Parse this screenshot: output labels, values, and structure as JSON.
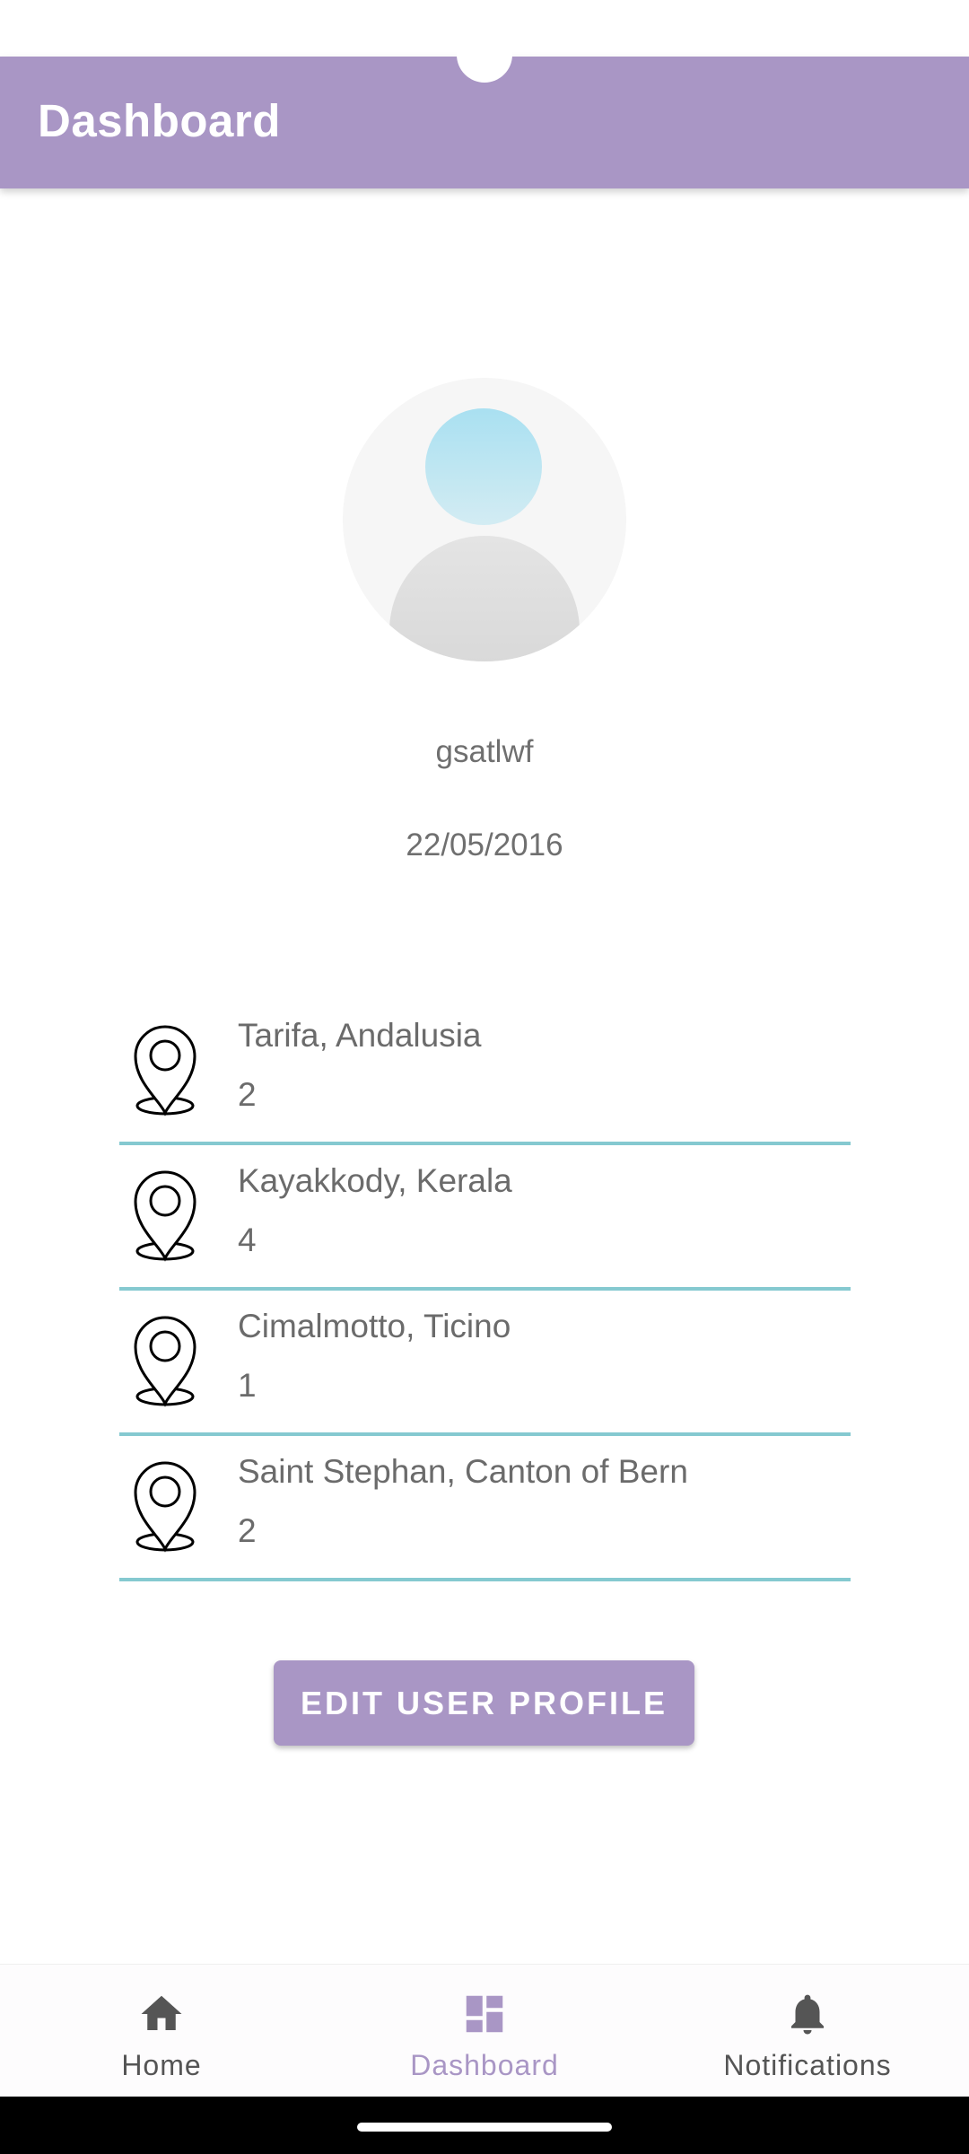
{
  "app_bar": {
    "title": "Dashboard"
  },
  "profile": {
    "username": "gsatlwf",
    "date": "22/05/2016"
  },
  "places": [
    {
      "name": "Tarifa, Andalusia",
      "count": "2",
      "icon": "location-pin-icon"
    },
    {
      "name": "Kayakkody, Kerala",
      "count": "4",
      "icon": "location-pin-icon"
    },
    {
      "name": "Cimalmotto, Ticino",
      "count": "1",
      "icon": "location-pin-icon"
    },
    {
      "name": "Saint Stephan, Canton of Bern",
      "count": "2",
      "icon": "location-pin-icon"
    }
  ],
  "actions": {
    "edit_profile_label": "EDIT USER PROFILE"
  },
  "bottom_nav": {
    "items": [
      {
        "label": "Home",
        "icon": "home-icon",
        "active": false
      },
      {
        "label": "Dashboard",
        "icon": "dashboard-icon",
        "active": true
      },
      {
        "label": "Notifications",
        "icon": "bell-icon",
        "active": false
      }
    ]
  },
  "colors": {
    "primary": "#a996c5",
    "divider": "#85c9d0",
    "text": "#6b6b6b",
    "nav_inactive": "#555555"
  }
}
